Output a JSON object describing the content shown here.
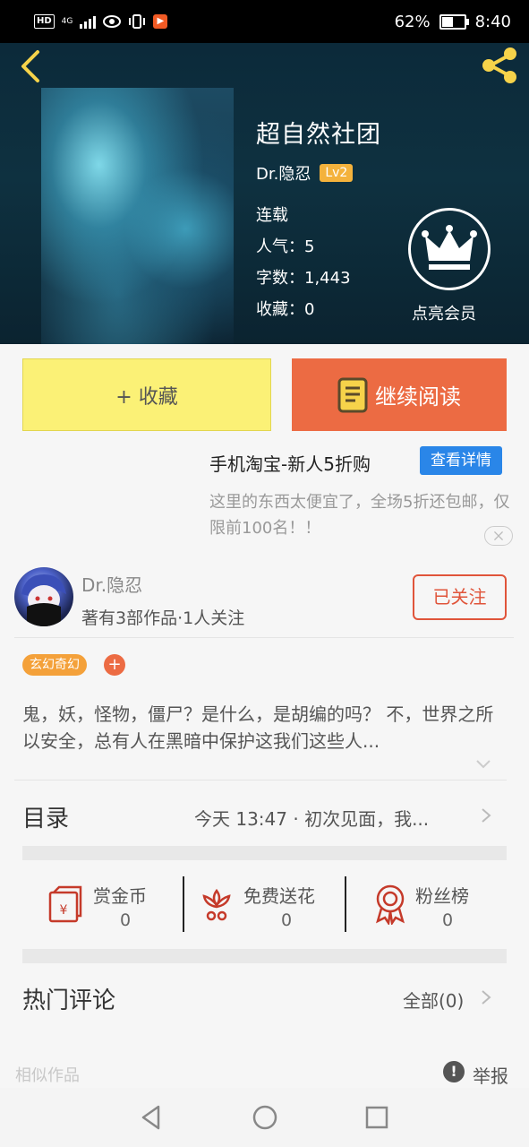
{
  "status_bar": {
    "hd": "HD",
    "network": "4G",
    "battery_percent": "62%",
    "battery_level": 0.62,
    "time": "8:40"
  },
  "book": {
    "title": "超自然社团",
    "author": "Dr.隐忍",
    "level": "Lv2",
    "status": "连载",
    "popularity": "人气：5",
    "word_count": "字数：1,443",
    "favorites": "收藏：0",
    "vip_label": "点亮会员"
  },
  "actions": {
    "collect": "+ 收藏",
    "continue_reading": "继续阅读"
  },
  "ad": {
    "title": "手机淘宝-新人5折购",
    "button": "查看详情",
    "desc": "这里的东西太便宜了，全场5折还包邮，仅限前100名！！"
  },
  "author_section": {
    "name": "Dr.隐忍",
    "stats": "著有3部作品·1人关注",
    "follow": "已关注"
  },
  "tag": "玄幻奇幻",
  "tag_add": "+",
  "description": "鬼，妖，怪物，僵尸？是什么，是胡编的吗？ 不，世界之所以安全，总有人在黑暗中保护这我们这些人...",
  "toc": {
    "label": "目录",
    "latest": "今天 13:47 · 初次见面，我..."
  },
  "stats": [
    {
      "label": "赏金币",
      "value": "0",
      "icon": "reward-coin-icon"
    },
    {
      "label": "免费送花",
      "value": "0",
      "icon": "flower-icon"
    },
    {
      "label": "粉丝榜",
      "value": "0",
      "icon": "medal-icon"
    }
  ],
  "comments": {
    "label": "热门评论",
    "all": "全部(0)"
  },
  "footer": {
    "similar": "相似作品",
    "report": "举报",
    "report_icon": "!"
  },
  "colors": {
    "accent_orange": "#ec6b43",
    "collect_yellow": "#fbf176",
    "ad_blue": "#2a86e8",
    "level_badge": "#f4b23c",
    "follow_red": "#e0543a"
  }
}
